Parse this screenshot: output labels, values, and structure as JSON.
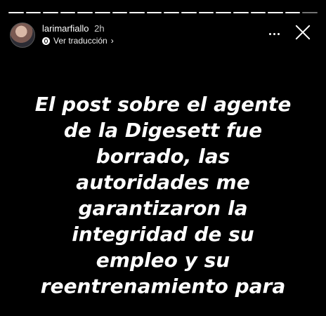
{
  "story": {
    "progress_segments": [
      true,
      true,
      true,
      true,
      true,
      true,
      true,
      true,
      true,
      true,
      true,
      true,
      true,
      true,
      true,
      true,
      true,
      false
    ],
    "username": "larimarfiallo",
    "time_ago": "2h",
    "translate_label": "Ver traducción",
    "lines": [
      "El post sobre el agente",
      "de la Digesett fue",
      "borrado, las",
      "autoridades me",
      "garantizaron la",
      "integridad de su",
      "empleo y su",
      "reentrenamiento para"
    ]
  }
}
